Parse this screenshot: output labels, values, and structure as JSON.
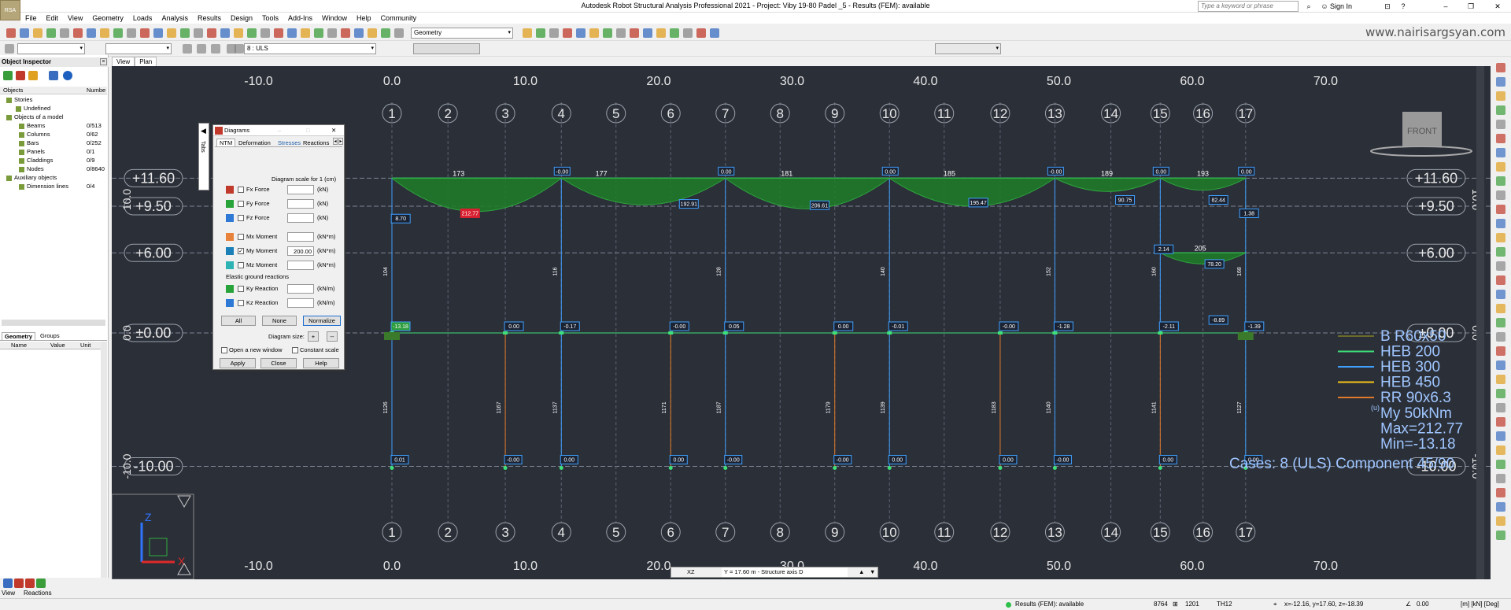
{
  "window": {
    "title": "Autodesk Robot Structural Analysis Professional 2021 - Project: Viby 19-80 Padel _5 - Results (FEM): available",
    "app_badge": "RSA"
  },
  "search": {
    "placeholder": "Type a keyword or phrase"
  },
  "signin": "Sign In",
  "menu": [
    "File",
    "Edit",
    "View",
    "Geometry",
    "Loads",
    "Analysis",
    "Results",
    "Design",
    "Tools",
    "Add-Ins",
    "Window",
    "Help",
    "Community"
  ],
  "toolbar": {
    "layout_combo": "Geometry",
    "case_combo": "8 : ULS"
  },
  "watermark": "www.nairisargsyan.com",
  "inspector": {
    "title": "Object Inspector",
    "col_objects": "Objects",
    "col_number": "Numbe",
    "tree": [
      {
        "label": "Stories",
        "num": "",
        "indent": 8
      },
      {
        "label": "Undefined",
        "num": "",
        "indent": 20
      },
      {
        "label": "Objects of a model",
        "num": "",
        "indent": 8
      },
      {
        "label": "Beams",
        "num": "0/513",
        "indent": 24
      },
      {
        "label": "Columns",
        "num": "0/62",
        "indent": 24
      },
      {
        "label": "Bars",
        "num": "0/252",
        "indent": 24
      },
      {
        "label": "Panels",
        "num": "0/1",
        "indent": 24
      },
      {
        "label": "Claddings",
        "num": "0/9",
        "indent": 24
      },
      {
        "label": "Nodes",
        "num": "0/8640",
        "indent": 24
      },
      {
        "label": "Auxiliary objects",
        "num": "",
        "indent": 8
      },
      {
        "label": "Dimension lines",
        "num": "0/4",
        "indent": 24
      }
    ],
    "tabs": [
      "Geometry",
      "Groups"
    ],
    "prop_cols": [
      "Name",
      "Value",
      "Unit"
    ]
  },
  "view_tabs": [
    "View",
    "Plan"
  ],
  "dialog": {
    "title": "Diagrams",
    "tabs": [
      "NTM",
      "Deformation",
      "Stresses",
      "Reactions"
    ],
    "side_tab": "Tabs",
    "scale_label": "Diagram scale for 1  (cm)",
    "rows": [
      {
        "label": "Fx Force",
        "value": "",
        "unit": "(kN)",
        "color": "#c0392b",
        "checked": false
      },
      {
        "label": "Fy Force",
        "value": "",
        "unit": "(kN)",
        "color": "#27a33a",
        "checked": false
      },
      {
        "label": "Fz Force",
        "value": "",
        "unit": "(kN)",
        "color": "#2e79d6",
        "checked": false
      },
      {
        "label": "Mx Moment",
        "value": "",
        "unit": "(kN*m)",
        "color": "#e8813a",
        "checked": false
      },
      {
        "label": "My Moment",
        "value": "200.00",
        "unit": "(kN*m)",
        "color": "#1b7fb8",
        "checked": true
      },
      {
        "label": "Mz Moment",
        "value": "",
        "unit": "(kN*m)",
        "color": "#2db3b3",
        "checked": false
      }
    ],
    "ground_label": "Elastic ground reactions",
    "ground_rows": [
      {
        "label": "Ky Reaction",
        "value": "",
        "unit": "(kN/m)",
        "color": "#27a33a",
        "checked": false
      },
      {
        "label": "Kz Reaction",
        "value": "",
        "unit": "(kN/m)",
        "color": "#2e79d6",
        "checked": false
      }
    ],
    "btn_all": "All",
    "btn_none": "None",
    "btn_normalize": "Normalize",
    "size_label": "Diagram size:",
    "size_plus": "+",
    "size_minus": "--",
    "open_new": "Open a new window",
    "const_scale": "Constant scale",
    "btn_apply": "Apply",
    "btn_close": "Close",
    "btn_help": "Help"
  },
  "view": {
    "x_ticks": [
      "-10.0",
      "0.0",
      "10.0",
      "20.0",
      "30.0",
      "40.0",
      "50.0",
      "60.0",
      "70.0"
    ],
    "x_tick_values": [
      -10,
      0,
      10,
      20,
      30,
      40,
      50,
      60,
      70
    ],
    "axis_ids": [
      "1",
      "2",
      "3",
      "4",
      "5",
      "6",
      "7",
      "8",
      "9",
      "10",
      "11",
      "12",
      "13",
      "14",
      "15",
      "16",
      "17"
    ],
    "levels": [
      {
        "label": "+11.60",
        "value": 11.6
      },
      {
        "label": "+9.50",
        "value": 9.5
      },
      {
        "label": "+6.00",
        "value": 6.0
      },
      {
        "label": "±0.00",
        "value": 0.0
      },
      {
        "label": "-10.00",
        "value": -10.0
      }
    ],
    "side_levels_left": [
      "10.0",
      "0.0",
      "-10.0"
    ],
    "side_levels_right": [
      "10.0",
      "0.0",
      "-10.0"
    ],
    "viewcube": "FRONT",
    "beam_moments": [
      {
        "text": "-0.00"
      },
      {
        "text": "173"
      },
      {
        "text": "177"
      },
      {
        "text": "0.00"
      },
      {
        "text": "181"
      },
      {
        "text": "0.00"
      },
      {
        "text": "185"
      },
      {
        "text": "-0.00"
      },
      {
        "text": "189"
      },
      {
        "text": "0.00"
      },
      {
        "text": "193"
      },
      {
        "text": "0.00"
      },
      {
        "text": "205"
      }
    ],
    "max_labels": [
      "212.77",
      "192.91",
      "206.61",
      "195.47",
      "90.75",
      "82.44",
      "78.20",
      "8.70",
      "2.14",
      "1.38",
      "-8.89"
    ],
    "mid_values": [
      "-13.18",
      "0.00",
      "-0.17",
      "-0.00",
      "0.05",
      "0.00",
      "-0.01",
      "-0.00",
      "-1.28",
      "-2.11",
      "-1.39"
    ],
    "base_values": [
      "0.01",
      "-0.00",
      "0.00",
      "0.00",
      "-0.00",
      "-0.00",
      "0.00",
      "0.00",
      "-0.00",
      "0.00",
      "0.00"
    ],
    "col_ids_upper": [
      "104",
      "116",
      "128",
      "140",
      "152",
      "160",
      "168"
    ],
    "col_ids_lower": [
      "1126",
      "1167",
      "1137",
      "1171",
      "1187",
      "1179",
      "1139",
      "1183",
      "1140",
      "1141",
      "1127"
    ],
    "legend": [
      {
        "label": "B R60x50",
        "color": "#6b6b2a"
      },
      {
        "label": "HEB 200",
        "color": "#3fe07a"
      },
      {
        "label": "HEB 300",
        "color": "#3fa0ff"
      },
      {
        "label": "HEB 450",
        "color": "#f5c518"
      },
      {
        "label": "RR 90x6.3",
        "color": "#e07a2a"
      }
    ],
    "legend_text": [
      "My  50kNm",
      "Max=212.77",
      "Min=-13.18"
    ],
    "cases_label": "Cases: 8 (ULS) Component 45/90",
    "small_label": "(u)"
  },
  "axis_box": {
    "axis": "XZ",
    "value": "Y = 17.60 m - Structure axis D"
  },
  "bottom_tabs": [
    "View",
    "Reactions"
  ],
  "status": {
    "results": "Results (FEM): available",
    "n1": "8764",
    "n2": "1201",
    "section": "TH12",
    "coords": "x=-12.16, y=17.60, z=-18.39",
    "angle": "0.00",
    "units": "[m] [kN] [Deg]"
  }
}
